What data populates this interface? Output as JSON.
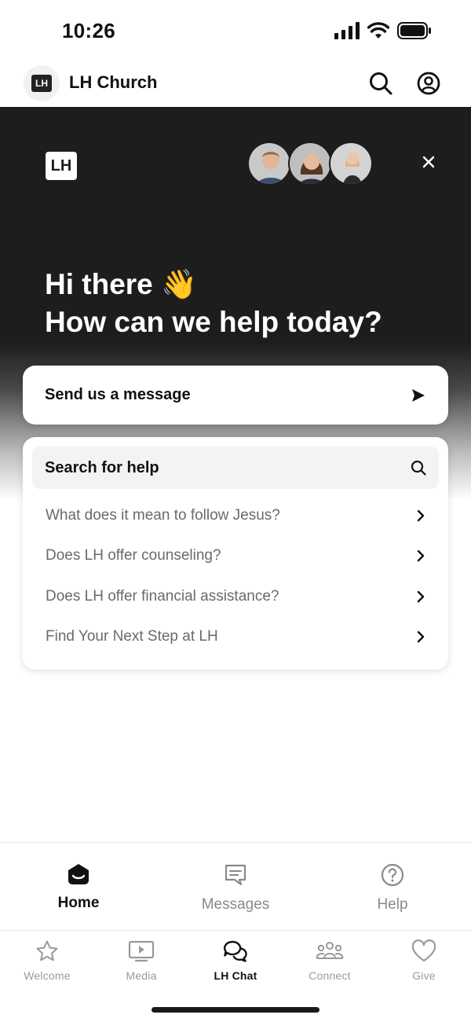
{
  "status_bar": {
    "time": "10:26"
  },
  "header": {
    "logo_text": "LH",
    "title": "LH Church",
    "icons": [
      "search-icon",
      "account-icon"
    ]
  },
  "hero": {
    "logo_text": "LH",
    "greeting_line1": "Hi there 👋",
    "greeting_line2": "How can we help today?",
    "team_avatar_count": 3,
    "close_icon": "close-icon"
  },
  "message_card": {
    "label": "Send us a message",
    "icon": "send-arrow-icon"
  },
  "help_card": {
    "search_label": "Search for help",
    "search_icon": "search-icon",
    "items": [
      {
        "label": "What does it mean to follow Jesus?"
      },
      {
        "label": "Does LH offer counseling?"
      },
      {
        "label": "Does LH offer financial assistance?"
      },
      {
        "label": "Find Your Next Step at LH"
      }
    ]
  },
  "chat_nav": {
    "tabs": [
      {
        "label": "Home",
        "icon": "home-icon",
        "active": true
      },
      {
        "label": "Messages",
        "icon": "messages-icon",
        "active": false
      },
      {
        "label": "Help",
        "icon": "help-icon",
        "active": false
      }
    ]
  },
  "tab_bar": {
    "tabs": [
      {
        "label": "Welcome",
        "icon": "star-icon",
        "active": false
      },
      {
        "label": "Media",
        "icon": "media-icon",
        "active": false
      },
      {
        "label": "LH Chat",
        "icon": "chat-icon",
        "active": true
      },
      {
        "label": "Connect",
        "icon": "people-icon",
        "active": false
      },
      {
        "label": "Give",
        "icon": "heart-icon",
        "active": false
      }
    ]
  },
  "colors": {
    "hero_background": "#1d1d1d",
    "active_text": "#111111",
    "inactive_text": "#9a9a9a",
    "card_background": "#ffffff"
  }
}
